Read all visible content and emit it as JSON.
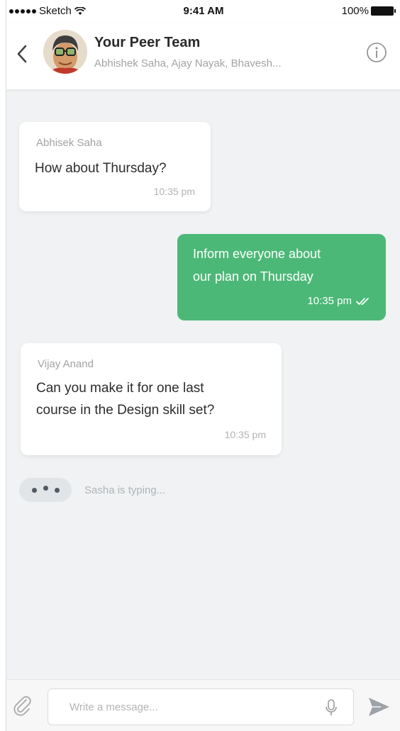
{
  "status_bar": {
    "carrier": "Sketch",
    "time": "9:41 AM",
    "battery": "100%"
  },
  "header": {
    "title": "Your Peer Team",
    "subtitle": "Abhishek Saha, Ajay Nayak, Bhavesh..."
  },
  "messages": [
    {
      "direction": "incoming",
      "sender": "Abhisek Saha",
      "lines": [
        "How about Thursday?"
      ],
      "time": "10:35 pm"
    },
    {
      "direction": "outgoing",
      "lines": [
        "Inform everyone about",
        "our plan on Thursday"
      ],
      "time": "10:35 pm",
      "status": "read"
    },
    {
      "direction": "incoming",
      "sender": "Vijay Anand",
      "lines": [
        "Can you make it for one last",
        "course in the Design skill set?"
      ],
      "time": "10:35 pm"
    }
  ],
  "typing": {
    "text": "Sasha is typing..."
  },
  "composer": {
    "placeholder": "Write a message..."
  },
  "colors": {
    "outgoing_bubble": "#4cb877",
    "background": "#f0f2f3"
  }
}
